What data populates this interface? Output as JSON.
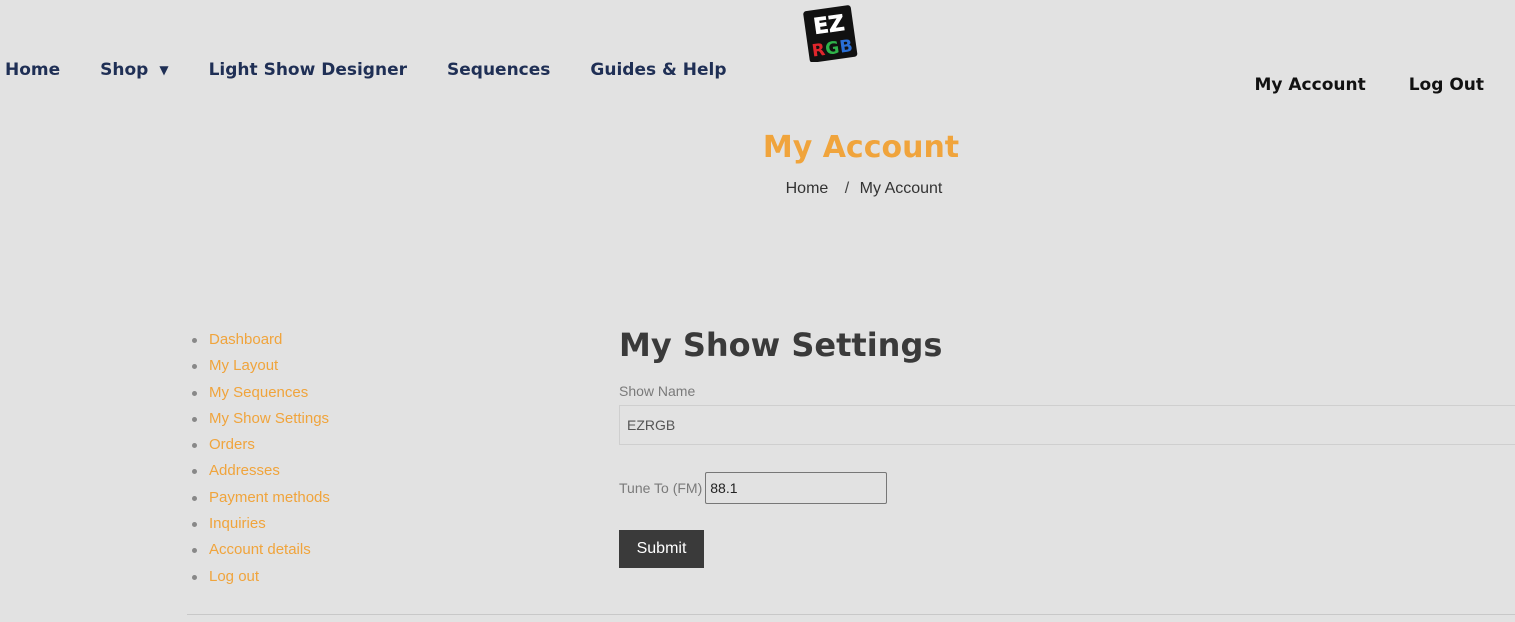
{
  "header": {
    "nav": [
      {
        "label": "Home"
      },
      {
        "label": "Shop"
      },
      {
        "label": "Light Show Designer"
      },
      {
        "label": "Sequences"
      },
      {
        "label": "Guides & Help"
      }
    ],
    "logo": {
      "line1": "EZ",
      "r": "R",
      "g": "G",
      "b": "B"
    },
    "right_nav": [
      {
        "label": "My Account"
      },
      {
        "label": "Log Out"
      }
    ]
  },
  "page": {
    "title": "My Account",
    "breadcrumb": {
      "home": "Home",
      "separator": "/",
      "current": "My Account"
    }
  },
  "account_nav": [
    "Dashboard",
    "My Layout",
    "My Sequences",
    "My Show Settings",
    "Orders",
    "Addresses",
    "Payment methods",
    "Inquiries",
    "Account details",
    "Log out"
  ],
  "settings": {
    "heading": "My Show Settings",
    "show_name_label": "Show Name",
    "show_name_value": "EZRGB",
    "tune_label": "Tune To (FM)",
    "tune_value": "88.1",
    "submit_label": "Submit"
  },
  "colors": {
    "accent": "#f0a43c",
    "nav_text": "#1f2f55",
    "background": "#e2e2e2",
    "button": "#3a3a3a"
  }
}
